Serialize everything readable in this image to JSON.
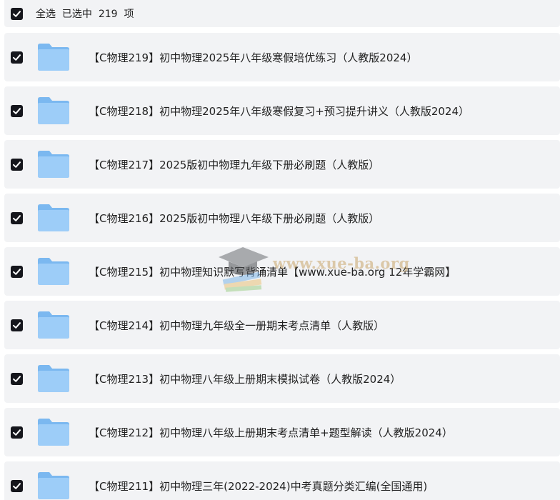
{
  "header": {
    "select_all_label": "全选",
    "selected_prefix": "已选中",
    "selected_count": "219",
    "selected_suffix": "项"
  },
  "colors": {
    "row_background": "#f2f3f5",
    "checkbox": "#15161c",
    "folder": "#8cc4f5"
  },
  "files": [
    {
      "name": "【C物理219】初中物理2025年八年级寒假培优练习（人教版2024）",
      "checked": true,
      "icon": "folder-icon"
    },
    {
      "name": "【C物理218】初中物理2025年八年级寒假复习+预习提升讲义（人教版2024）",
      "checked": true,
      "icon": "folder-icon"
    },
    {
      "name": "【C物理217】2025版初中物理九年级下册必刷题（人教版）",
      "checked": true,
      "icon": "folder-icon"
    },
    {
      "name": "【C物理216】2025版初中物理八年级下册必刷题（人教版）",
      "checked": true,
      "icon": "folder-icon"
    },
    {
      "name": "【C物理215】初中物理知识默写背诵清单【www.xue-ba.org 12年学霸网】",
      "checked": true,
      "icon": "folder-icon"
    },
    {
      "name": "【C物理214】初中物理九年级全一册期末考点清单（人教版）",
      "checked": true,
      "icon": "folder-icon"
    },
    {
      "name": "【C物理213】初中物理八年级上册期末模拟试卷（人教版2024）",
      "checked": true,
      "icon": "folder-icon"
    },
    {
      "name": "【C物理212】初中物理八年级上册期末考点清单+题型解读（人教版2024）",
      "checked": true,
      "icon": "folder-icon"
    },
    {
      "name": "【C物理211】初中物理三年(2022-2024)中考真题分类汇编(全国通用)",
      "checked": true,
      "icon": "folder-icon"
    }
  ],
  "watermark": {
    "text": "www.xue-ba.org",
    "icon": "graduation-cap-icon"
  }
}
